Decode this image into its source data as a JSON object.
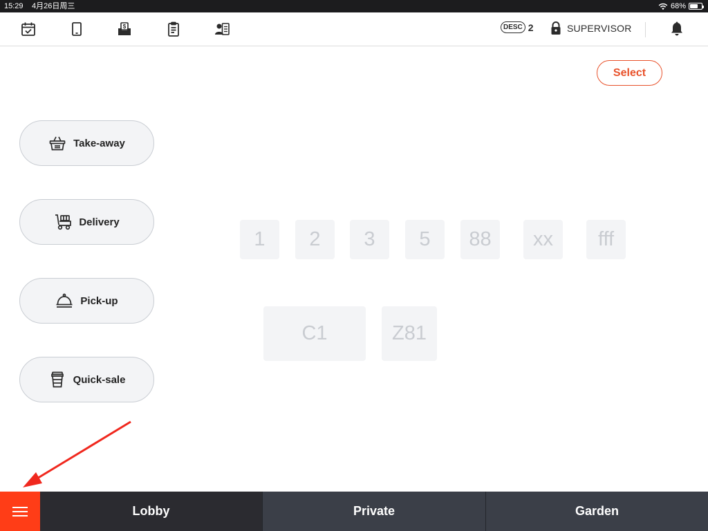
{
  "status_bar": {
    "time": "15:29",
    "date": "4月26日周三",
    "battery": "68%",
    "battery_level": 0.68
  },
  "toolbar": {
    "icons": [
      "calendar-check-icon",
      "tablet-icon",
      "cash-tray-icon",
      "clipboard-icon",
      "user-card-icon"
    ],
    "desc_label": "DESC",
    "desc_count": "2",
    "supervisor_label": "SUPERVISOR"
  },
  "select_label": "Select",
  "order_types": [
    {
      "label": "Take-away",
      "icon": "basket-icon"
    },
    {
      "label": "Delivery",
      "icon": "delivery-cart-icon"
    },
    {
      "label": "Pick-up",
      "icon": "cloche-icon"
    },
    {
      "label": "Quick-sale",
      "icon": "cup-icon"
    }
  ],
  "tables": [
    "1",
    "2",
    "3",
    "5",
    "88",
    "xx",
    "fff",
    "C1",
    "Z81"
  ],
  "bottom_bar": {
    "menu_icon": "hamburger-menu-icon",
    "tabs": [
      "Lobby",
      "Private",
      "Garden"
    ],
    "active_tab": "Lobby"
  },
  "colors": {
    "accent": "#e8512a",
    "menu_button": "#ff3d17",
    "bottom_bar": "#3b3f48",
    "arrow": "#f0281e"
  }
}
